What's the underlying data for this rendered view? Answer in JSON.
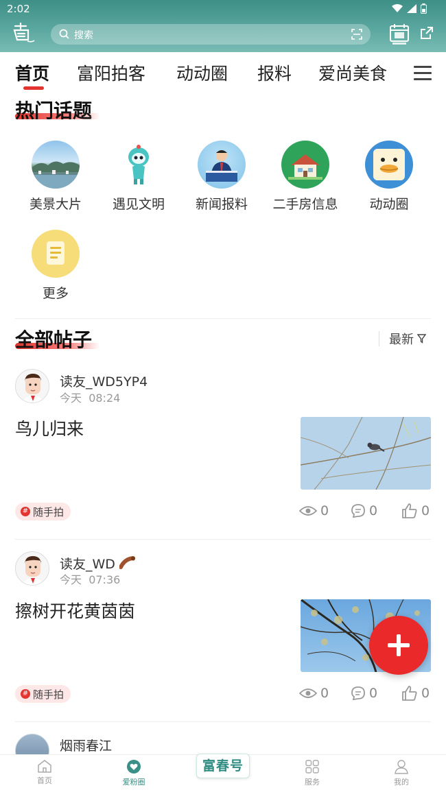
{
  "status_bar": {
    "time": "2:02"
  },
  "search": {
    "placeholder": "搜索"
  },
  "tabs": [
    "首页",
    "富阳拍客",
    "动动圈",
    "报料",
    "爱尚美食"
  ],
  "hot_topics": {
    "title": "热门话题",
    "items": [
      {
        "label": "美景大片",
        "icon": "landscape-photo"
      },
      {
        "label": "遇见文明",
        "icon": "mascot-robot"
      },
      {
        "label": "新闻报料",
        "icon": "news-reporter"
      },
      {
        "label": "二手房信息",
        "icon": "house"
      },
      {
        "label": "动动圈",
        "icon": "duck-face"
      },
      {
        "label": "更多",
        "icon": "document-more"
      }
    ]
  },
  "all_posts": {
    "title": "全部帖子",
    "sort_label": "最新"
  },
  "posts": [
    {
      "author": "读友_WD5YP4",
      "day": "今天",
      "time": "08:24",
      "title": "鸟儿归来",
      "tag": "随手拍",
      "views": "0",
      "comments": "0",
      "likes": "0"
    },
    {
      "author": "读友_WD",
      "day": "今天",
      "time": "07:36",
      "title": "擦树开花黄茵茵",
      "tag": "随手拍",
      "views": "0",
      "comments": "0",
      "likes": "0"
    },
    {
      "author": "烟雨春江"
    }
  ],
  "bottom_nav": {
    "items": [
      "首页",
      "爱粉圈",
      "服务",
      "我的"
    ],
    "center_label": "富春号",
    "active": "爱粉圈"
  },
  "colors": {
    "accent": "#e3342f",
    "brand": "#3a8f86"
  }
}
